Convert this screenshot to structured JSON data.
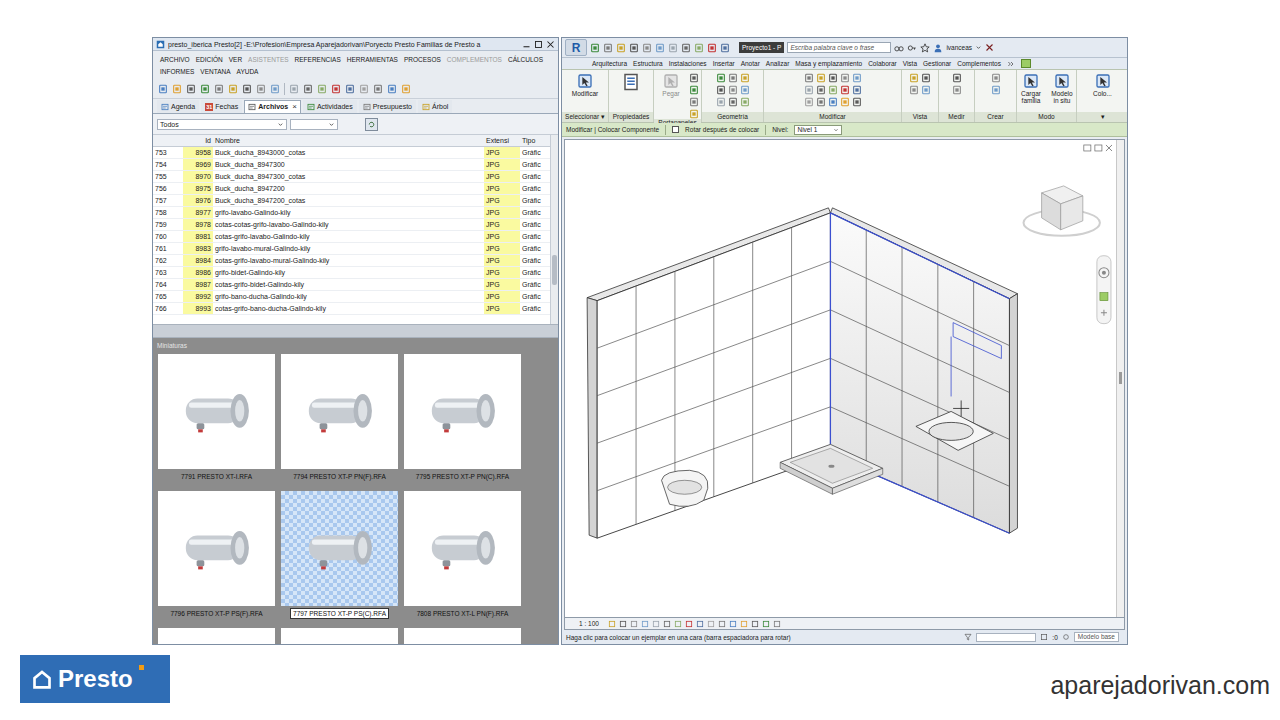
{
  "presto": {
    "title": "presto_iberica Presto[2] -E:\\Profesion\\Empresa Aparejadorivan\\Poryecto Presto Familias de Presto a",
    "menu": [
      {
        "label": "ARCHIVO",
        "disabled": false
      },
      {
        "label": "EDICIÓN",
        "disabled": false
      },
      {
        "label": "VER",
        "disabled": false
      },
      {
        "label": "ASISTENTES",
        "disabled": true
      },
      {
        "label": "REFERENCIAS",
        "disabled": false
      },
      {
        "label": "HERRAMIENTAS",
        "disabled": false
      },
      {
        "label": "PROCESOS",
        "disabled": false
      },
      {
        "label": "COMPLEMENTOS",
        "disabled": true
      },
      {
        "label": "CÁLCULOS",
        "disabled": false
      },
      {
        "label": "INFORMES",
        "disabled": false
      },
      {
        "label": "VENTANA",
        "disabled": false
      },
      {
        "label": "AYUDA",
        "disabled": false
      }
    ],
    "tabs": [
      {
        "label": "Agenda",
        "selected": false
      },
      {
        "label": "Fechas",
        "selected": false,
        "icon_text": "31"
      },
      {
        "label": "Archivos",
        "selected": true,
        "close": "×"
      },
      {
        "label": "Actividades",
        "selected": false
      },
      {
        "label": "Presupuesto",
        "selected": false
      },
      {
        "label": "Árbol",
        "selected": false
      }
    ],
    "filter": {
      "value": "Todos"
    },
    "table": {
      "columns": [
        "Id",
        "Nombre",
        "Extensi",
        "Tipo"
      ],
      "rows": [
        [
          "753",
          "8958",
          "Buck_ducha_8943000_cotas",
          "JPG",
          "Gráfic"
        ],
        [
          "754",
          "8969",
          "Buck_ducha_8947300",
          "JPG",
          "Gráfic"
        ],
        [
          "755",
          "8970",
          "Buck_ducha_8947300_cotas",
          "JPG",
          "Gráfic"
        ],
        [
          "756",
          "8975",
          "Buck_ducha_8947200",
          "JPG",
          "Gráfic"
        ],
        [
          "757",
          "8976",
          "Buck_ducha_8947200_cotas",
          "JPG",
          "Gráfic"
        ],
        [
          "758",
          "8977",
          "grifo-lavabo-Galindo-kily",
          "JPG",
          "Gráfic"
        ],
        [
          "759",
          "8978",
          "cotas-cotas-grifo-lavabo-Galindo-kily",
          "JPG",
          "Gráfic"
        ],
        [
          "760",
          "8981",
          "cotas-grifo-lavabo-Galindo-kily",
          "JPG",
          "Gráfic"
        ],
        [
          "761",
          "8983",
          "grifo-lavabo-mural-Galindo-kily",
          "JPG",
          "Gráfic"
        ],
        [
          "762",
          "8984",
          "cotas-grifo-lavabo-mural-Galindo-kily",
          "JPG",
          "Gráfic"
        ],
        [
          "763",
          "8986",
          "grifo-bidet-Galindo-kily",
          "JPG",
          "Gráfic"
        ],
        [
          "764",
          "8987",
          "cotas-grifo-bidet-Galindo-kily",
          "JPG",
          "Gráfic"
        ],
        [
          "765",
          "8992",
          "grifo-bano-ducha-Galindo-kily",
          "JPG",
          "Gráfic"
        ],
        [
          "766",
          "8993",
          "cotas-grifo-bano-ducha-Galindo-kily",
          "JPG",
          "Gráfic"
        ]
      ]
    },
    "thumbnails": {
      "title": "Miniaturas",
      "items": [
        {
          "label": "7791 PRESTO XT-I.RFA",
          "selected": false
        },
        {
          "label": "7794 PRESTO XT-P PN(F).RFA",
          "selected": false
        },
        {
          "label": "7795 PRESTO XT-P PN(C).RFA",
          "selected": false
        },
        {
          "label": "7796 PRESTO XT-P PS(F).RFA",
          "selected": false
        },
        {
          "label": "7797 PRESTO XT-P PS(C).RFA",
          "selected": true
        },
        {
          "label": "7808 PRESTO XT-L PN(F).RFA",
          "selected": false
        }
      ]
    }
  },
  "revit": {
    "logo": "R",
    "title": "Proyecto1 - P",
    "search": {
      "placeholder": "Escriba palabra clave o frase"
    },
    "user": "ivanceas",
    "ribbon_tabs": [
      "Arquitectura",
      "Estructura",
      "Instalaciones",
      "Insertar",
      "Anotar",
      "Analizar",
      "Masa y emplazamiento",
      "Colaborar",
      "Vista",
      "Gestionar",
      "Complementos"
    ],
    "panels": [
      {
        "label": "Seleccionar ▾",
        "buttons": [
          {
            "label": "Modificar",
            "disabled": false
          }
        ]
      },
      {
        "label": "Propiedades",
        "buttons": []
      },
      {
        "label": "Portapapeles",
        "buttons": [
          {
            "label": "Pegar",
            "disabled": true
          }
        ]
      },
      {
        "label": "Geometría",
        "buttons": []
      },
      {
        "label": "Modificar",
        "buttons": []
      },
      {
        "label": "Vista",
        "buttons": []
      },
      {
        "label": "Medir",
        "buttons": []
      },
      {
        "label": "Crear",
        "buttons": []
      },
      {
        "label": "Modo",
        "buttons": [
          {
            "label": "Cargar familia",
            "disabled": false
          },
          {
            "label": "Modelo in situ",
            "disabled": false
          }
        ]
      },
      {
        "label": "▾",
        "buttons": [
          {
            "label": "Colo...",
            "disabled": false
          }
        ]
      }
    ],
    "options_bar": {
      "context": "Modificar | Colocar Componente",
      "rotate": {
        "label": "Rotar después de colocar",
        "checked": false
      },
      "level_label": "Nivel:",
      "level": "Nivel 1"
    },
    "view_bar": {
      "scale": "1 : 100"
    },
    "status_bar": {
      "text": "Haga clic para colocar un ejemplar en una cara (barra espaciadora para rotar)",
      "count": ":0",
      "model": "Modelo base"
    }
  },
  "branding": {
    "logo": "Presto",
    "site": "aparejadorivan.com"
  }
}
